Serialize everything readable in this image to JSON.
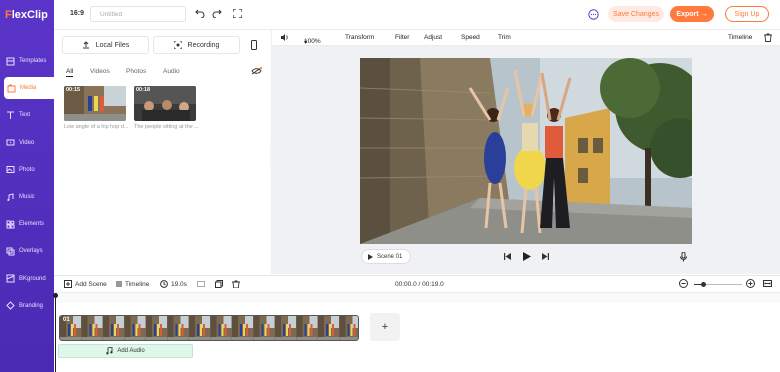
{
  "app": {
    "logo_flex": "F",
    "logo_rest": "lexClip",
    "aspect": "16:9",
    "title_placeholder": "Untitled",
    "save": "Save Changes",
    "export": "Export",
    "signup": "Sign Up"
  },
  "sidebar": {
    "items": [
      {
        "label": "Templates",
        "icon": "templates-icon"
      },
      {
        "label": "Media",
        "icon": "media-icon"
      },
      {
        "label": "Text",
        "icon": "text-icon"
      },
      {
        "label": "Video",
        "icon": "video-icon"
      },
      {
        "label": "Photo",
        "icon": "photo-icon"
      },
      {
        "label": "Music",
        "icon": "music-icon"
      },
      {
        "label": "Elements",
        "icon": "elements-icon"
      },
      {
        "label": "Overlays",
        "icon": "overlays-icon"
      },
      {
        "label": "BKground",
        "icon": "bkground-icon"
      },
      {
        "label": "Branding",
        "icon": "branding-icon"
      }
    ]
  },
  "panel": {
    "local_files": "Local Files",
    "recording": "Recording",
    "tabs": [
      "All",
      "Videos",
      "Photos",
      "Audio"
    ],
    "media": [
      {
        "duration": "00:15",
        "caption": "Low angle of a hip hop d..."
      },
      {
        "duration": "00:18",
        "caption": "The people sitting at the ..."
      }
    ]
  },
  "toolbar": {
    "zoom": "100%",
    "transform": "Transform",
    "filter": "Filter",
    "adjust": "Adjust",
    "speed": "Speed",
    "trim": "Trim",
    "timeline": "Timeline"
  },
  "player": {
    "scene": "Scene 01"
  },
  "timeline": {
    "add_scene": "Add Scene",
    "timeline": "Timeline",
    "duration": "19.0s",
    "time": "00:00.0 / 00:19.0",
    "clip_label": "01",
    "add_audio": "Add Audio",
    "plus": "+"
  },
  "colors": {
    "purple": "#5b35c9",
    "orange": "#ff7a3c"
  }
}
